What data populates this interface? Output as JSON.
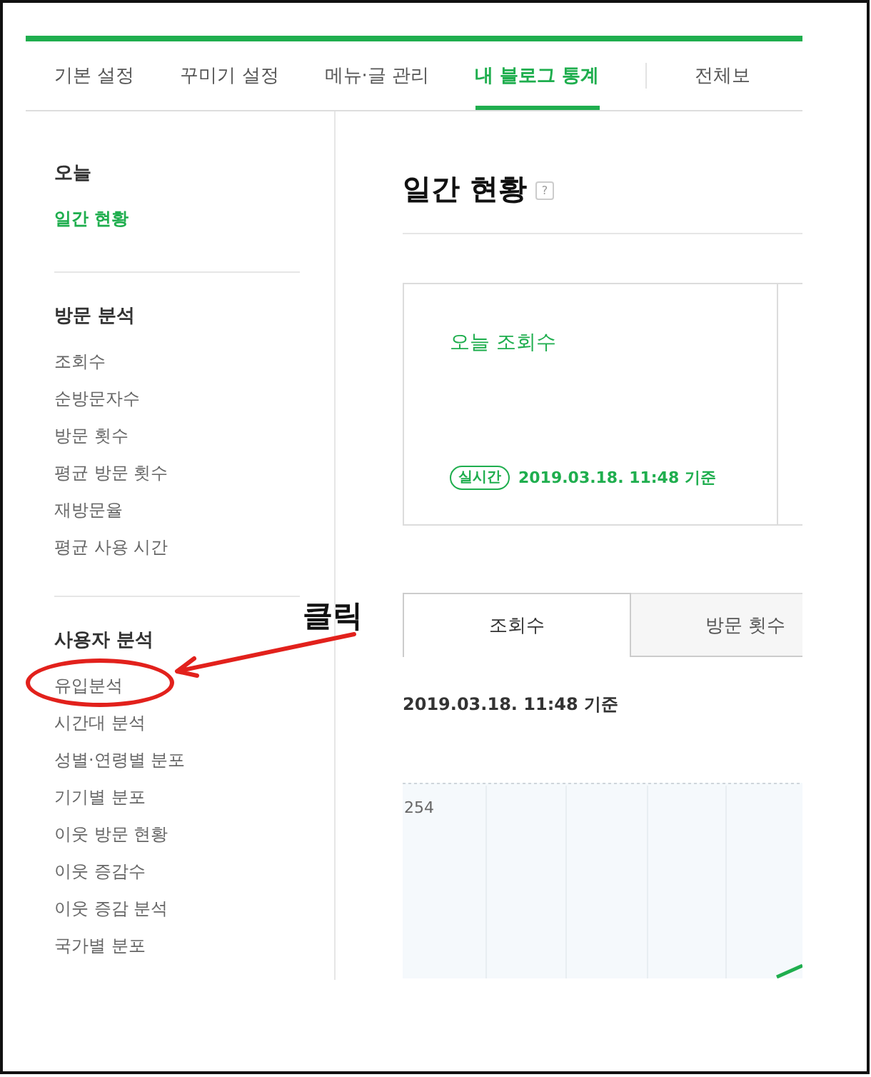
{
  "top_tabs": [
    {
      "label": "기본 설정",
      "selected": false
    },
    {
      "label": "꾸미기 설정",
      "selected": false
    },
    {
      "label": "메뉴·글 관리",
      "selected": false
    },
    {
      "label": "내 블로그 통계",
      "selected": true
    }
  ],
  "more_tab": {
    "label": "전체보"
  },
  "sidebar": {
    "sections": [
      {
        "title": "오늘",
        "items": [
          {
            "label": "일간 현황",
            "selected": true,
            "circled": false
          }
        ]
      },
      {
        "title": "방문 분석",
        "items": [
          {
            "label": "조회수",
            "selected": false,
            "circled": false
          },
          {
            "label": "순방문자수",
            "selected": false,
            "circled": false
          },
          {
            "label": "방문 횟수",
            "selected": false,
            "circled": false
          },
          {
            "label": "평균 방문 횟수",
            "selected": false,
            "circled": false
          },
          {
            "label": "재방문율",
            "selected": false,
            "circled": false
          },
          {
            "label": "평균 사용 시간",
            "selected": false,
            "circled": false
          }
        ]
      },
      {
        "title": "사용자 분석",
        "items": [
          {
            "label": "유입분석",
            "selected": false,
            "circled": true
          },
          {
            "label": "시간대 분석",
            "selected": false,
            "circled": false
          },
          {
            "label": "성별·연령별 분포",
            "selected": false,
            "circled": false
          },
          {
            "label": "기기별 분포",
            "selected": false,
            "circled": false
          },
          {
            "label": "이웃 방문 현황",
            "selected": false,
            "circled": false
          },
          {
            "label": "이웃 증감수",
            "selected": false,
            "circled": false
          },
          {
            "label": "이웃 증감 분석",
            "selected": false,
            "circled": false
          },
          {
            "label": "국가별 분포",
            "selected": false,
            "circled": false
          }
        ]
      }
    ]
  },
  "main": {
    "title": "일간 현황",
    "help": "?",
    "card": {
      "title": "오늘 조회수",
      "badge": "실시간",
      "timestamp": "2019.03.18. 11:48 기준"
    },
    "tabs": [
      {
        "label": "조회수",
        "selected": true
      },
      {
        "label": "방문 횟수",
        "selected": false
      }
    ],
    "timestamp": "2019.03.18. 11:48 기준",
    "chart": {
      "top_label": "254"
    }
  },
  "annotation": {
    "label": "클릭"
  }
}
